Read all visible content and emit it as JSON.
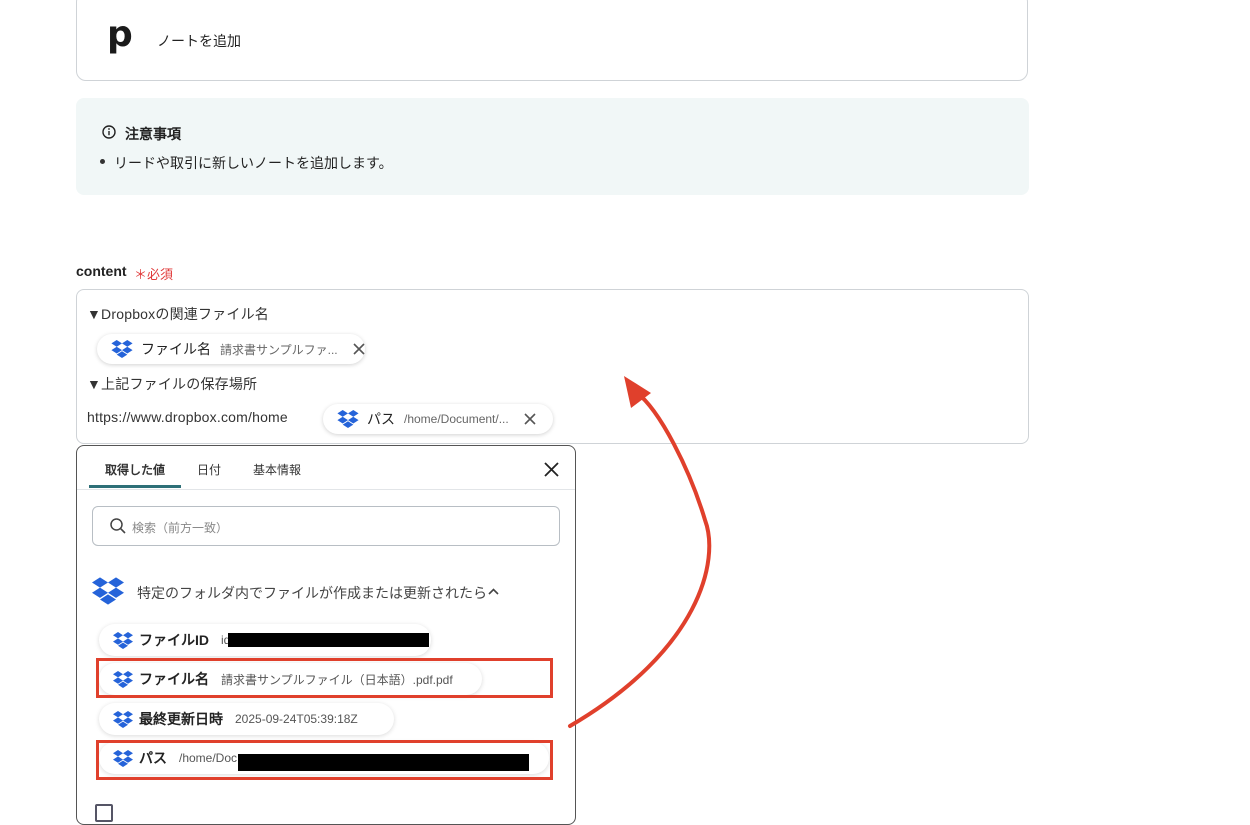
{
  "action_card": {
    "label": "ノートを追加"
  },
  "notice": {
    "title": "注意事項",
    "items": [
      "リードや取引に新しいノートを追加します。"
    ]
  },
  "content_field": {
    "label": "content",
    "required": "＊必須",
    "line1": "▼Dropboxの関連ファイル名",
    "line2": "▼上記ファイルの保存場所",
    "url_text": "https://www.dropbox.com/home",
    "chips": [
      {
        "name": "ファイル名",
        "value": "請求書サンプルファ..."
      },
      {
        "name": "パス",
        "value": "/home/Document/..."
      }
    ]
  },
  "panel": {
    "tabs": [
      "取得した値",
      "日付",
      "基本情報"
    ],
    "active_tab": "取得した値",
    "search_placeholder": "検索（前方一致）",
    "trigger_title": "特定のフォルダ内でファイルが作成または更新されたら",
    "values": [
      {
        "name": "ファイルID",
        "value": "id",
        "redacted": true
      },
      {
        "name": "ファイル名",
        "value": "請求書サンプルファイル（日本語）.pdf.pdf",
        "highlighted": true
      },
      {
        "name": "最終更新日時",
        "value": "2025-09-24T05:39:18Z"
      },
      {
        "name": "パス",
        "value": "/home/Doc",
        "redacted": true,
        "highlighted": true
      }
    ]
  },
  "colors": {
    "dropbox_blue": "#2563d9",
    "highlight_red": "#e0402c",
    "required_red": "#e03a3a",
    "tab_accent": "#2e6f77",
    "notice_bg": "#f1f7f7"
  },
  "icons": [
    "pipedrive-logo",
    "info-icon",
    "dropbox-icon",
    "close-icon",
    "search-icon",
    "chevron-up-icon"
  ]
}
